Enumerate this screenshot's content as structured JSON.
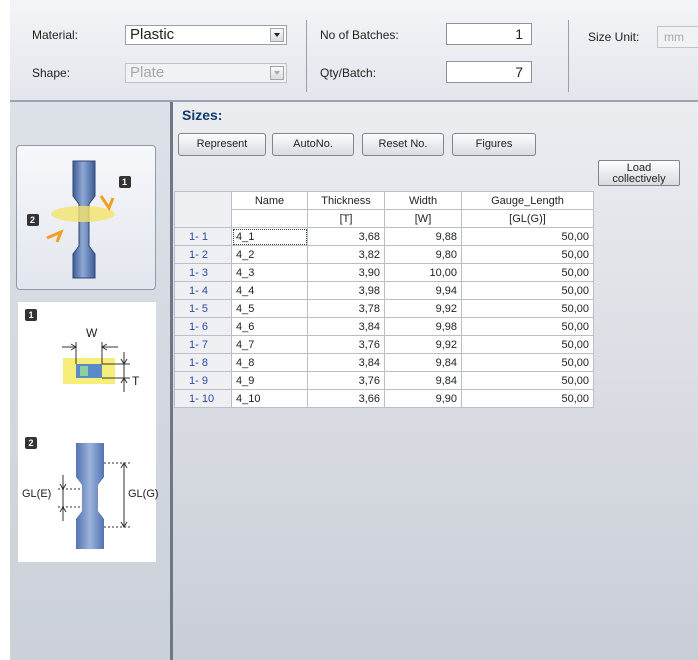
{
  "material": {
    "label": "Material:",
    "value": "Plastic"
  },
  "shape": {
    "label": "Shape:",
    "value": "Plate"
  },
  "batches": {
    "label": "No of Batches:",
    "value": "1"
  },
  "qty": {
    "label": "Qty/Batch:",
    "value": "7"
  },
  "size_unit": {
    "label": "Size Unit:",
    "value": "mm"
  },
  "sizes_title": "Sizes:",
  "buttons": {
    "represent": "Represent",
    "autono": "AutoNo.",
    "resetno": "Reset No.",
    "figures": "Figures",
    "load_line1": "Load",
    "load_line2": "collectively"
  },
  "diagram": {
    "marker1": "1",
    "marker2": "2",
    "w_label": "W",
    "t_label": "T",
    "gle_label": "GL(E)",
    "glg_label": "GL(G)"
  },
  "grid": {
    "columns": [
      "Name",
      "Thickness",
      "Width",
      "Gauge_Length"
    ],
    "units": [
      "",
      "[T]",
      "[W]",
      "[GL(G)]"
    ],
    "rows": [
      {
        "id": "1- 1",
        "name": "4_1",
        "thickness": "3,68",
        "width": "9,88",
        "gauge": "50,00"
      },
      {
        "id": "1- 2",
        "name": "4_2",
        "thickness": "3,82",
        "width": "9,80",
        "gauge": "50,00"
      },
      {
        "id": "1- 3",
        "name": "4_3",
        "thickness": "3,90",
        "width": "10,00",
        "gauge": "50,00"
      },
      {
        "id": "1- 4",
        "name": "4_4",
        "thickness": "3,98",
        "width": "9,94",
        "gauge": "50,00"
      },
      {
        "id": "1- 5",
        "name": "4_5",
        "thickness": "3,78",
        "width": "9,92",
        "gauge": "50,00"
      },
      {
        "id": "1- 6",
        "name": "4_6",
        "thickness": "3,84",
        "width": "9,98",
        "gauge": "50,00"
      },
      {
        "id": "1- 7",
        "name": "4_7",
        "thickness": "3,76",
        "width": "9,92",
        "gauge": "50,00"
      },
      {
        "id": "1- 8",
        "name": "4_8",
        "thickness": "3,84",
        "width": "9,84",
        "gauge": "50,00"
      },
      {
        "id": "1- 9",
        "name": "4_9",
        "thickness": "3,76",
        "width": "9,84",
        "gauge": "50,00"
      },
      {
        "id": "1- 10",
        "name": "4_10",
        "thickness": "3,66",
        "width": "9,90",
        "gauge": "50,00"
      }
    ]
  }
}
